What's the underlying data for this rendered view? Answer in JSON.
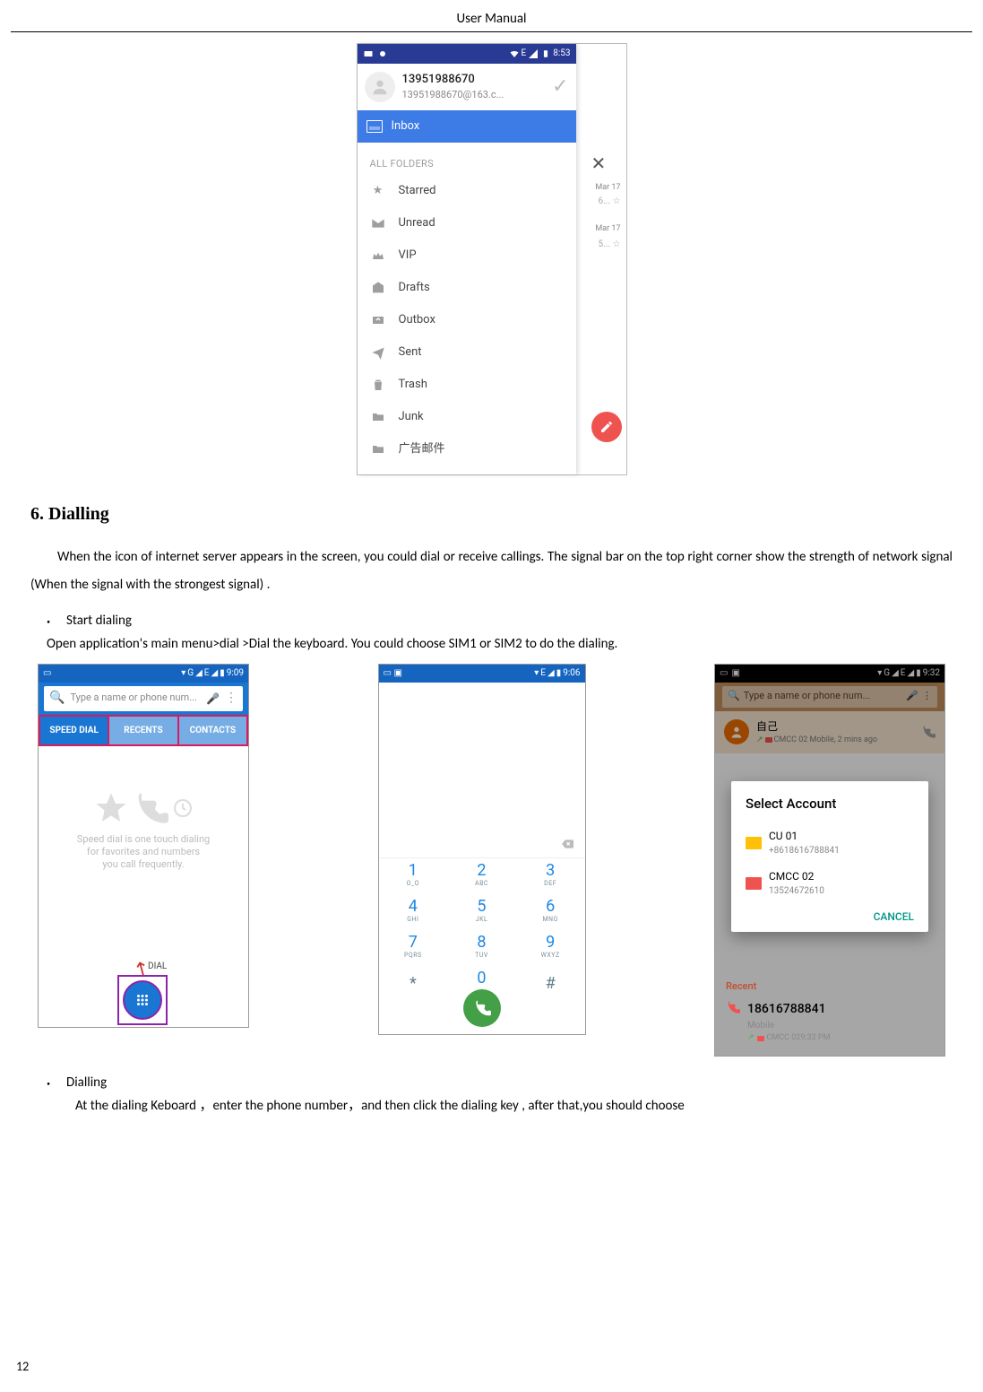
{
  "page": {
    "header": "User    Manual",
    "number": "12"
  },
  "mail_shot": {
    "statusbar": {
      "time": "8:53",
      "edge": "E"
    },
    "account": {
      "title": "13951988670",
      "sub": "13951988670@163.c..."
    },
    "inbox_label": "Inbox",
    "all_folders": "ALL FOLDERS",
    "folders": [
      "Starred",
      "Unread",
      "VIP",
      "Drafts",
      "Outbox",
      "Sent",
      "Trash",
      "Junk",
      "广告邮件"
    ],
    "peek": {
      "date1": "Mar 17",
      "star1": "6...  ☆",
      "date2": "Mar 17",
      "star2": "5...  ☆"
    }
  },
  "section": {
    "heading": "6. Dialling",
    "intro": "When the icon of internet server appears in the screen, you could dial or receive callings. The signal bar on the top right corner show the strength of network signal (When the signal with the strongest signal) .",
    "bullet1": "Start dialing",
    "para1": "Open application's main menu>dial >Dial the keyboard. You could choose SIM1 or SIM2 to do the dialing.",
    "bullet2": "Dialling",
    "para2": "At the dialing Keboard  ，enter the phone number，and then click the dialing key , after that,you should choose"
  },
  "phone1": {
    "statusbar": {
      "time": "9:09",
      "edge": "G",
      "edge2": "E"
    },
    "search_placeholder": "Type a name or phone num...",
    "tabs": [
      "SPEED DIAL",
      "RECENTS",
      "CONTACTS"
    ],
    "empty_text": "Speed dial is one touch dialing\nfor favorites and numbers\nyou call frequently.",
    "dial_label": "DIAL"
  },
  "phone2": {
    "statusbar": {
      "time": "9:06",
      "edge": "E"
    },
    "keys": [
      {
        "n": "1",
        "s": "O_O"
      },
      {
        "n": "2",
        "s": "ABC"
      },
      {
        "n": "3",
        "s": "DEF"
      },
      {
        "n": "4",
        "s": "GHI"
      },
      {
        "n": "5",
        "s": "JKL"
      },
      {
        "n": "6",
        "s": "MNO"
      },
      {
        "n": "7",
        "s": "PQRS"
      },
      {
        "n": "8",
        "s": "TUV"
      },
      {
        "n": "9",
        "s": "WXYZ"
      },
      {
        "n": "*",
        "s": ""
      },
      {
        "n": "0",
        "s": "+"
      },
      {
        "n": "#",
        "s": ""
      }
    ]
  },
  "phone3": {
    "statusbar": {
      "time": "9:32",
      "edge": "G",
      "edge2": "E"
    },
    "search_placeholder": "Type a name or phone num...",
    "contact": {
      "name": "自己",
      "sub": "CMCC 02 Mobile, 2 mins ago"
    },
    "dialog": {
      "title": "Select Account",
      "opts": [
        {
          "name": "CU 01",
          "sub": "+8618616788841"
        },
        {
          "name": "CMCC 02",
          "sub": "13524672610"
        }
      ],
      "cancel": "CANCEL"
    },
    "recent_label": "Recent",
    "recent": {
      "num": "18616788841",
      "sub": "Mobile",
      "sub2": "CMCC 029:32 PM"
    }
  }
}
